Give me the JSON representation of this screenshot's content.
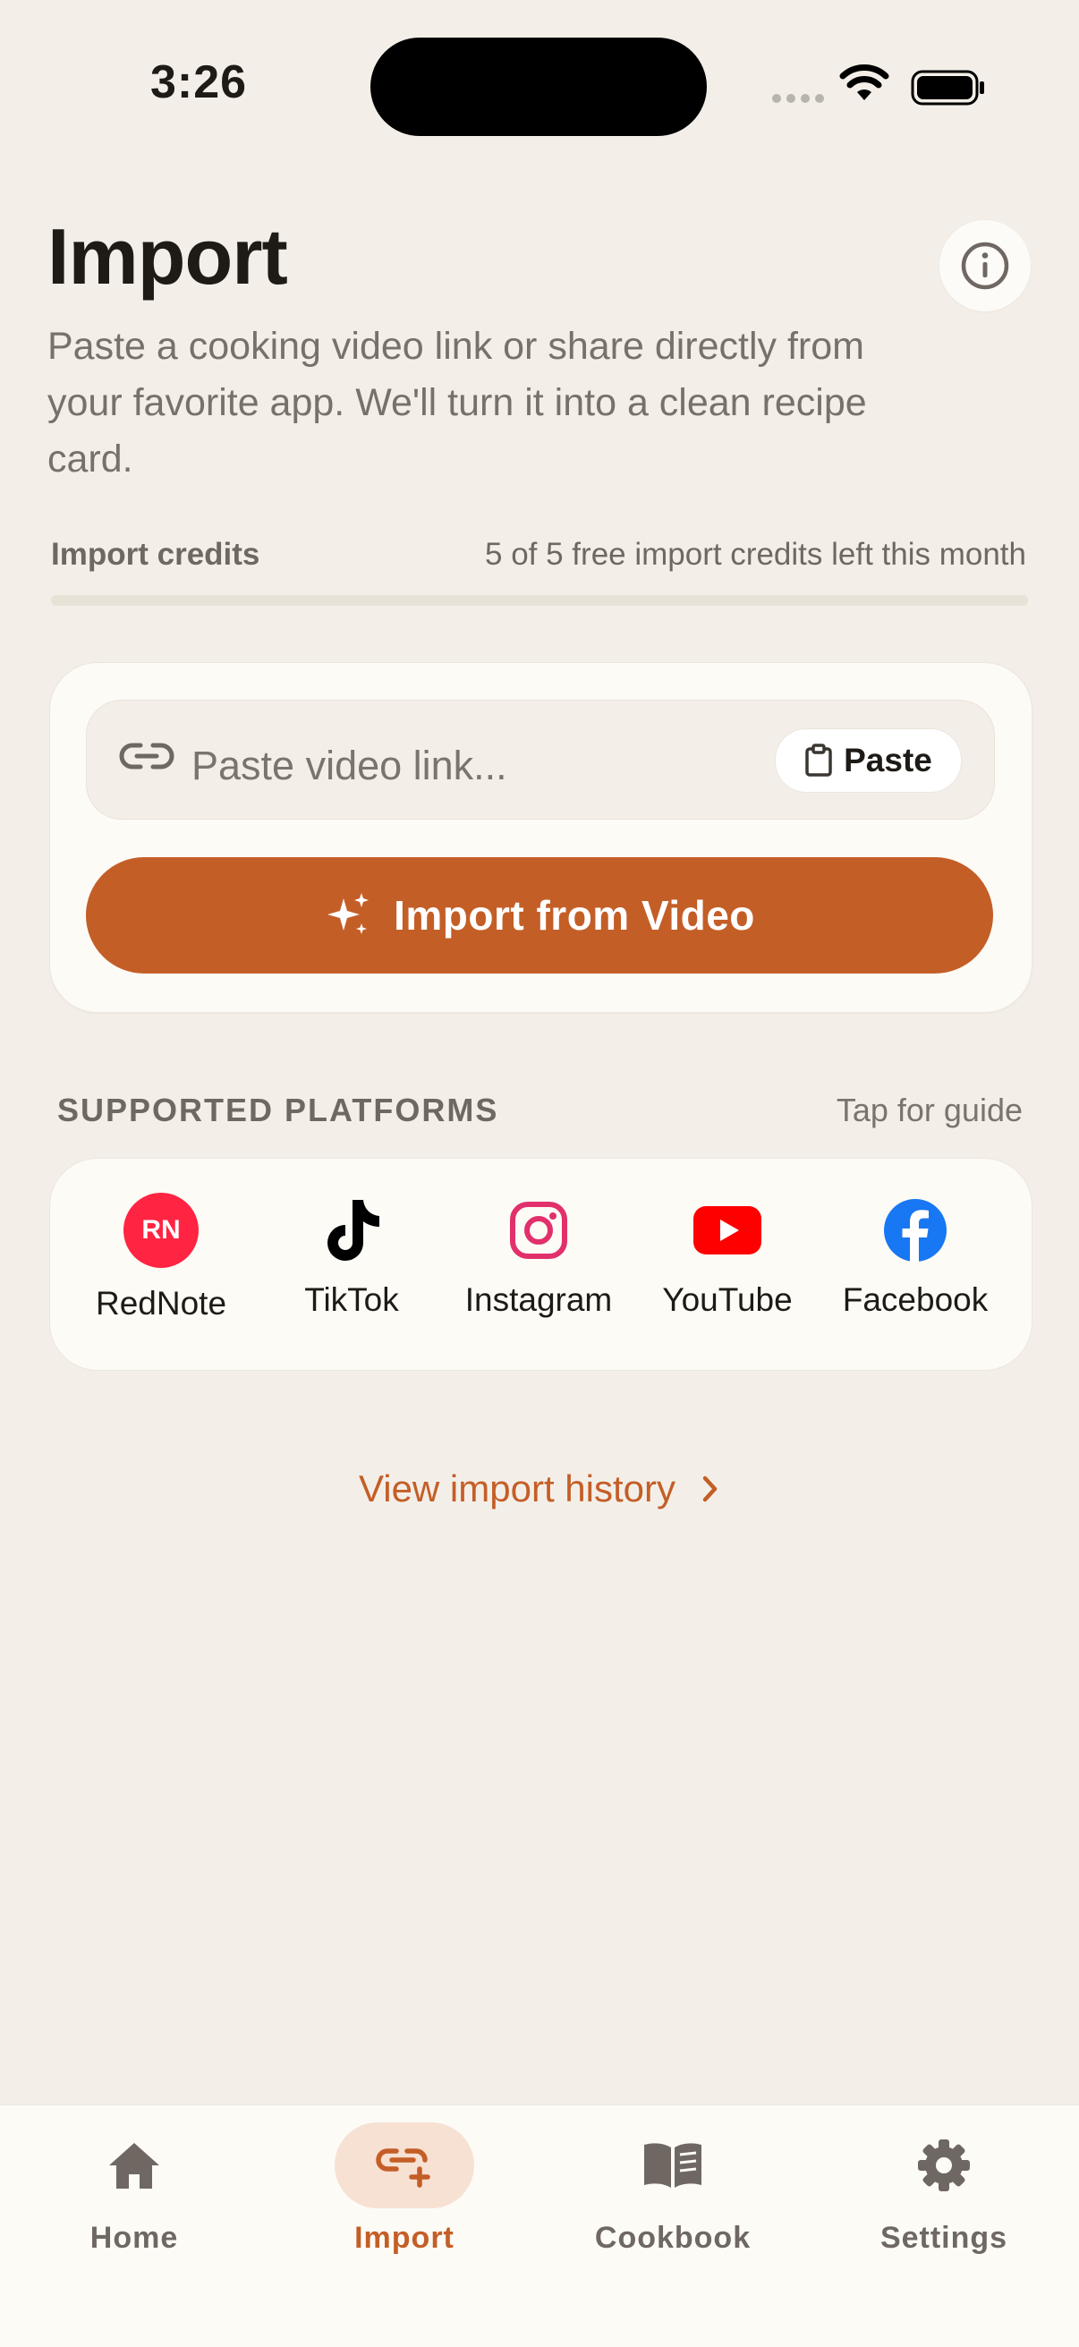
{
  "status_bar": {
    "time": "3:26"
  },
  "header": {
    "title": "Import",
    "subtitle": "Paste a cooking video link or share directly from your favorite app. We'll turn it into a clean recipe card.",
    "info_icon": "info-icon"
  },
  "credits": {
    "label": "Import credits",
    "text": "5 of 5 free import credits left this month",
    "used_fraction": 0
  },
  "import_card": {
    "input_placeholder": "Paste video link...",
    "input_value": "",
    "paste_label": "Paste",
    "import_button_label": "Import from Video"
  },
  "platforms": {
    "section_label": "SUPPORTED PLATFORMS",
    "guide_label": "Tap for guide",
    "items": [
      {
        "label": "RedNote",
        "icon": "rednote-icon",
        "badge": "RN",
        "color": "#ff2442"
      },
      {
        "label": "TikTok",
        "icon": "tiktok-icon",
        "color": "#000000"
      },
      {
        "label": "Instagram",
        "icon": "instagram-icon",
        "color": "#e1306c"
      },
      {
        "label": "YouTube",
        "icon": "youtube-icon",
        "color": "#ff0000"
      },
      {
        "label": "Facebook",
        "icon": "facebook-icon",
        "color": "#1877f2"
      }
    ]
  },
  "history": {
    "label": "View import history"
  },
  "tabbar": {
    "items": [
      {
        "label": "Home",
        "icon": "home-icon",
        "active": false
      },
      {
        "label": "Import",
        "icon": "import-link-icon",
        "active": true
      },
      {
        "label": "Cookbook",
        "icon": "book-icon",
        "active": false
      },
      {
        "label": "Settings",
        "icon": "gear-icon",
        "active": false
      }
    ]
  },
  "colors": {
    "background": "#f3efe8",
    "accent": "#c45e27",
    "card": "#fdfbf6",
    "muted_text": "#77716b"
  }
}
